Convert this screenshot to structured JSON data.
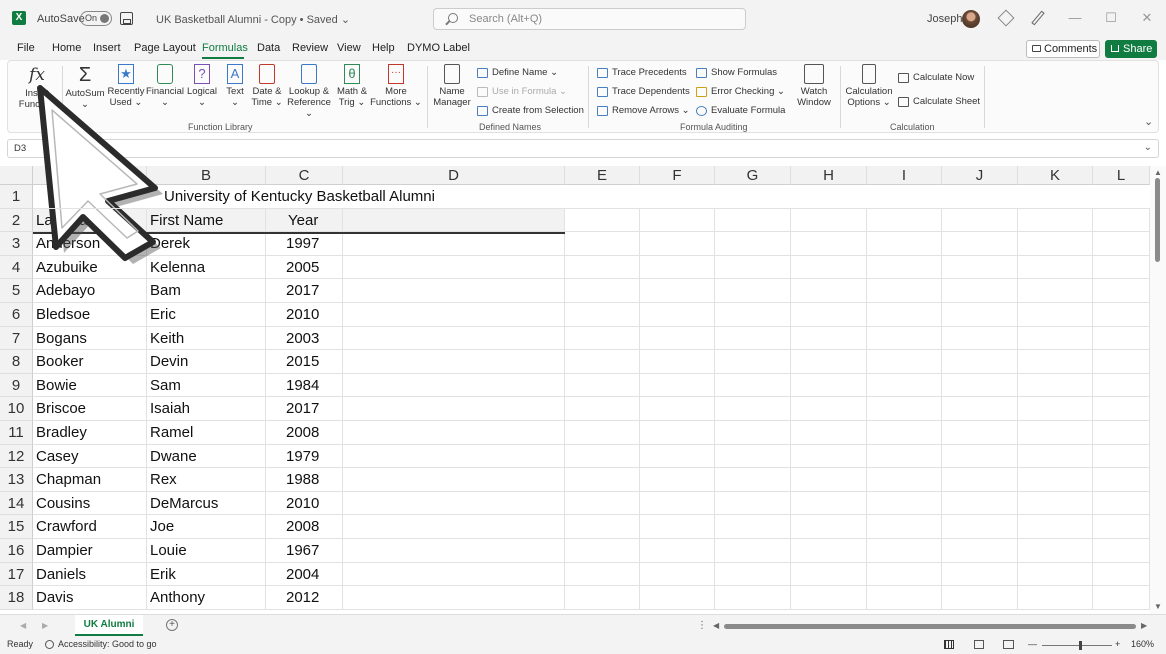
{
  "titlebar": {
    "app_icon": "excel-icon",
    "autosave_label": "AutoSave",
    "autosave_state": "On",
    "document_title": "UK Basketball Alumni - Copy • Saved ⌄",
    "search_placeholder": "Search (Alt+Q)",
    "user_name": "Joseph",
    "minimize": "—",
    "maximize": "☐",
    "close": "✕"
  },
  "menu": {
    "tabs": [
      "File",
      "Home",
      "Insert",
      "Page Layout",
      "Formulas",
      "Data",
      "Review",
      "View",
      "Help",
      "DYMO Label"
    ],
    "active_tab": "Formulas",
    "comments_label": "Comments",
    "share_label": "Share",
    "accent_color": "#107c41"
  },
  "ribbon": {
    "insert_function": {
      "line1": "Insert",
      "line2": "Function"
    },
    "autosum": {
      "line1": "AutoSum",
      "line2": "⌄"
    },
    "recently_used": {
      "line1": "Recently",
      "line2": "Used ⌄"
    },
    "financial": {
      "line1": "Financial",
      "line2": "⌄"
    },
    "logical": {
      "line1": "Logical",
      "line2": "⌄"
    },
    "text": {
      "line1": "Text",
      "line2": "⌄"
    },
    "date_time": {
      "line1": "Date &",
      "line2": "Time ⌄"
    },
    "lookup_reference": {
      "line1": "Lookup &",
      "line2": "Reference ⌄"
    },
    "math_trig": {
      "line1": "Math &",
      "line2": "Trig ⌄"
    },
    "more_functions": {
      "line1": "More",
      "line2": "Functions ⌄"
    },
    "function_library_label": "Function Library",
    "name_manager": {
      "line1": "Name",
      "line2": "Manager"
    },
    "define_name": "Define Name ⌄",
    "use_in_formula": "Use in Formula ⌄",
    "create_from_selection": "Create from Selection",
    "defined_names_label": "Defined Names",
    "trace_precedents": "Trace Precedents",
    "trace_dependents": "Trace Dependents",
    "remove_arrows": "Remove Arrows ⌄",
    "show_formulas": "Show Formulas",
    "error_checking": "Error Checking ⌄",
    "evaluate_formula": "Evaluate Formula",
    "watch_window": {
      "line1": "Watch",
      "line2": "Window"
    },
    "formula_auditing_label": "Formula Auditing",
    "calculation_options": {
      "line1": "Calculation",
      "line2": "Options ⌄"
    },
    "calculate_now": "Calculate Now",
    "calculate_sheet": "Calculate Sheet",
    "calculation_label": "Calculation",
    "collapse": "⌄"
  },
  "formula_bar": {
    "name_box": "D3",
    "chevron": "⌄"
  },
  "grid": {
    "columns": [
      "A",
      "B",
      "C",
      "D",
      "E",
      "F",
      "G",
      "H",
      "I",
      "J",
      "K",
      "L"
    ],
    "rows": [
      "1",
      "2",
      "3",
      "4",
      "5",
      "6",
      "7",
      "8",
      "9",
      "10",
      "11",
      "12",
      "13",
      "14",
      "15",
      "16",
      "17",
      "18"
    ],
    "title": "University of Kentucky Basketball Alumni",
    "headers": [
      "Last Name",
      "First Name",
      "Year"
    ],
    "records": [
      [
        "Anderson",
        "Derek",
        "1997"
      ],
      [
        "Azubuike",
        "Kelenna",
        "2005"
      ],
      [
        "Adebayo",
        "Bam",
        "2017"
      ],
      [
        "Bledsoe",
        "Eric",
        "2010"
      ],
      [
        "Bogans",
        "Keith",
        "2003"
      ],
      [
        "Booker",
        "Devin",
        "2015"
      ],
      [
        "Bowie",
        "Sam",
        "1984"
      ],
      [
        "Briscoe",
        "Isaiah",
        "2017"
      ],
      [
        "Bradley",
        "Ramel",
        "2008"
      ],
      [
        "Casey",
        "Dwane",
        "1979"
      ],
      [
        "Chapman",
        "Rex",
        "1988"
      ],
      [
        "Cousins",
        "DeMarcus",
        "2010"
      ],
      [
        "Crawford",
        "Joe",
        "2008"
      ],
      [
        "Dampier",
        "Louie",
        "1967"
      ],
      [
        "Daniels",
        "Erik",
        "2004"
      ],
      [
        "Davis",
        "Anthony",
        "2012"
      ]
    ]
  },
  "sheets": {
    "active": "UK Alumni",
    "add": "+"
  },
  "status": {
    "ready": "Ready",
    "accessibility": "Accessibility: Good to go",
    "zoom": "160%",
    "zoom_minus": "—",
    "zoom_plus": "+"
  }
}
